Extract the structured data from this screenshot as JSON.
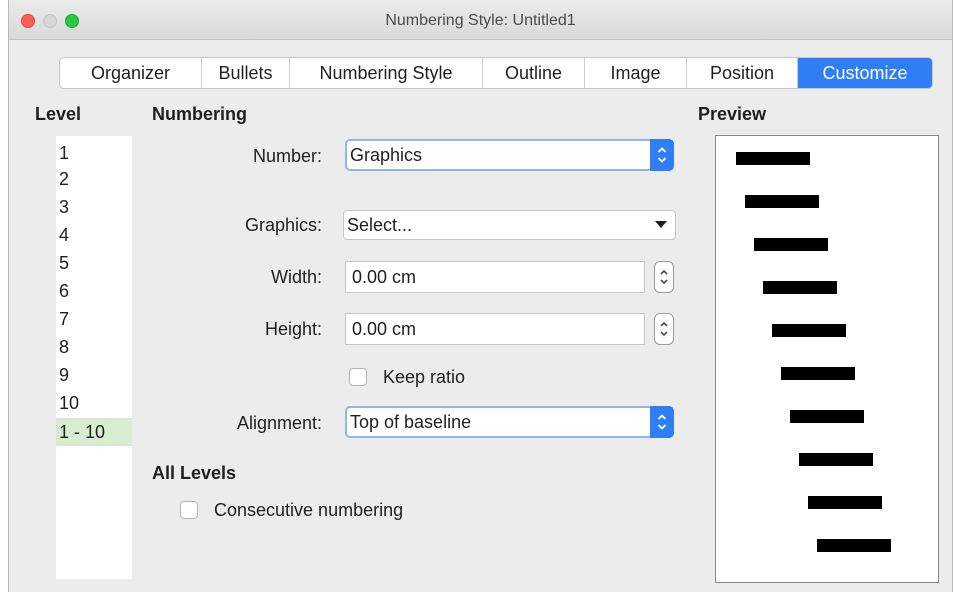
{
  "window": {
    "title": "Numbering Style: Untitled1"
  },
  "tabs": [
    {
      "label": "Organizer"
    },
    {
      "label": "Bullets"
    },
    {
      "label": "Numbering Style"
    },
    {
      "label": "Outline"
    },
    {
      "label": "Image"
    },
    {
      "label": "Position"
    },
    {
      "label": "Customize",
      "active": true
    }
  ],
  "level": {
    "heading": "Level",
    "items": [
      "1",
      "2",
      "3",
      "4",
      "5",
      "6",
      "7",
      "8",
      "9",
      "10",
      "1 - 10"
    ],
    "selected": "1 - 10"
  },
  "numbering": {
    "heading": "Numbering",
    "number_label": "Number:",
    "number_value": "Graphics",
    "graphics_label": "Graphics:",
    "graphics_value": "Select...",
    "width_label": "Width:",
    "width_value": "0.00 cm",
    "height_label": "Height:",
    "height_value": "0.00 cm",
    "keep_ratio_label": "Keep ratio",
    "keep_ratio_checked": false,
    "alignment_label": "Alignment:",
    "alignment_value": "Top of baseline"
  },
  "all_levels": {
    "heading": "All Levels",
    "consecutive_label": "Consecutive numbering",
    "consecutive_checked": false
  },
  "preview": {
    "heading": "Preview"
  },
  "colors": {
    "accent": "#2f7ef6",
    "selected_row": "#d7ecd0"
  }
}
